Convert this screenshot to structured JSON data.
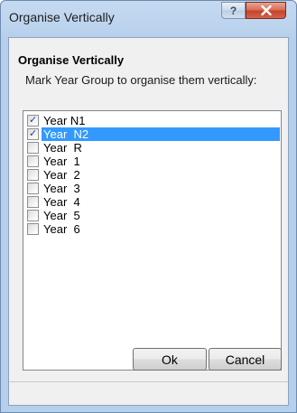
{
  "window": {
    "title": "Organise Vertically",
    "help_label": "?",
    "close_label": "close"
  },
  "group": {
    "title": "Organise Vertically",
    "instruction": "Mark Year Group to organise them vertically:"
  },
  "year_groups": [
    {
      "label": "Year N1",
      "checked": true,
      "selected": false
    },
    {
      "label": "Year  N2",
      "checked": true,
      "selected": true
    },
    {
      "label": "Year  R",
      "checked": false,
      "selected": false
    },
    {
      "label": "Year  1",
      "checked": false,
      "selected": false
    },
    {
      "label": "Year  2",
      "checked": false,
      "selected": false
    },
    {
      "label": "Year  3",
      "checked": false,
      "selected": false
    },
    {
      "label": "Year  4",
      "checked": false,
      "selected": false
    },
    {
      "label": "Year  5",
      "checked": false,
      "selected": false
    },
    {
      "label": "Year  6",
      "checked": false,
      "selected": false
    }
  ],
  "buttons": {
    "ok_label": "Ok",
    "cancel_label": "Cancel"
  },
  "colors": {
    "selection": "#3399ff",
    "close_button": "#c5432a",
    "frame": "#bcd3ee"
  }
}
